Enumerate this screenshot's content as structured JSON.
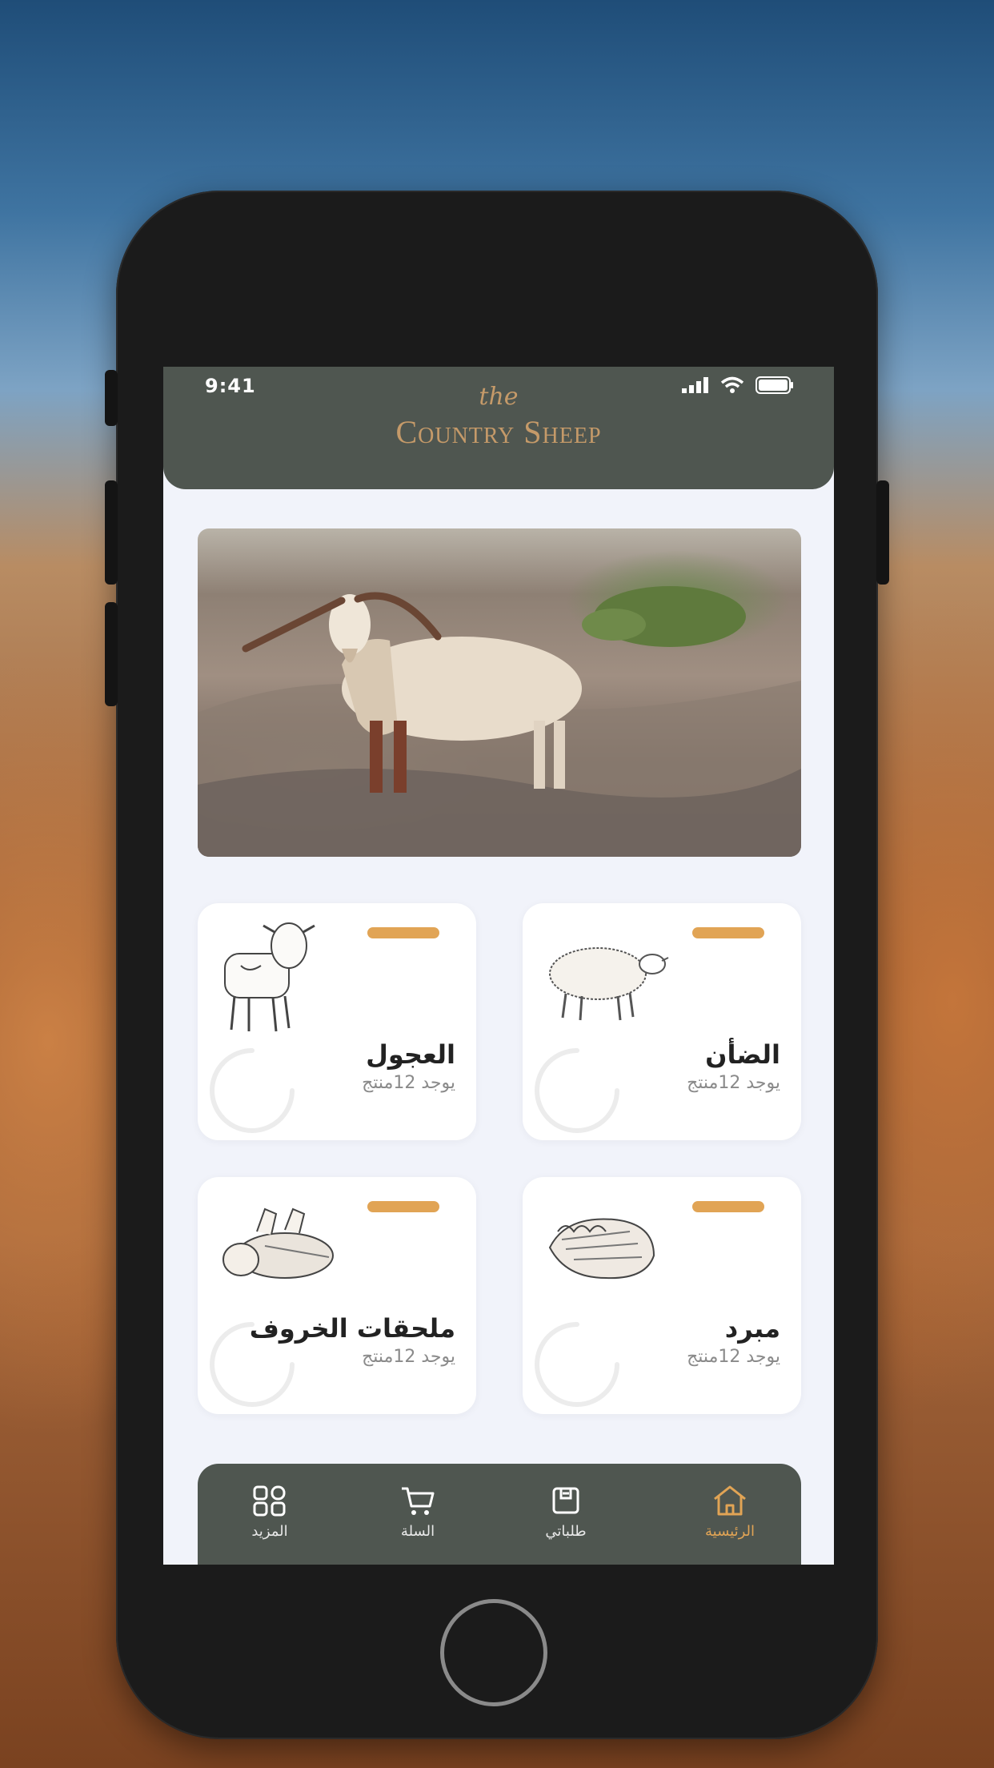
{
  "status_bar": {
    "time": "9:41"
  },
  "brand": {
    "small": "the",
    "name": "Country Sheep"
  },
  "categories": [
    {
      "title": "الضأن",
      "subtitle": "يوجد 12منتج",
      "icon": "sheep-illustration"
    },
    {
      "title": "العجول",
      "subtitle": "يوجد 12منتج",
      "icon": "calf-illustration"
    },
    {
      "title": "مبرد",
      "subtitle": "يوجد 12منتج",
      "icon": "chilled-meat-illustration"
    },
    {
      "title": "ملحقات الخروف",
      "subtitle": "يوجد 12منتج",
      "icon": "meat-cuts-illustration"
    }
  ],
  "nav": {
    "home": "الرئيسية",
    "orders": "طلباتي",
    "cart": "السلة",
    "more": "المزيد"
  },
  "colors": {
    "header": "#4f5650",
    "accent": "#e1a455",
    "brand_text": "#c59a69",
    "screen_bg": "#f1f3fa"
  }
}
